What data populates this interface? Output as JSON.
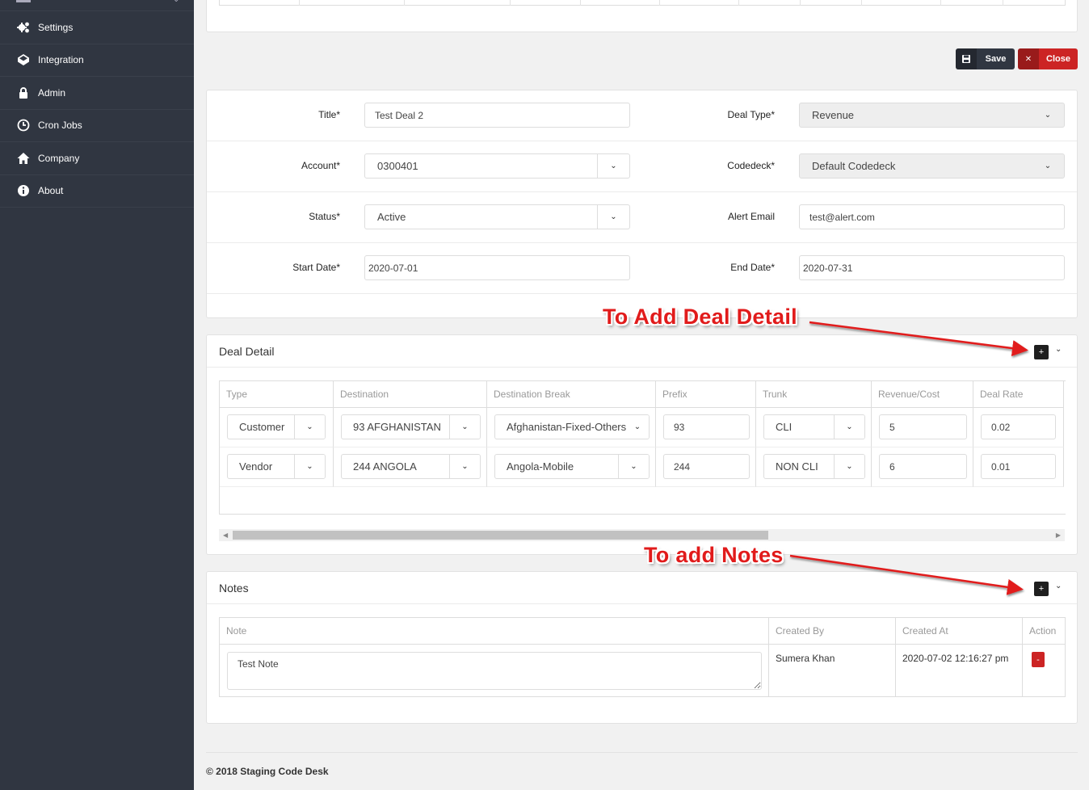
{
  "sidebar": {
    "items": [
      {
        "label": "Settings",
        "icon": "gears-icon"
      },
      {
        "label": "Integration",
        "icon": "codepen-icon"
      },
      {
        "label": "Admin",
        "icon": "lock-icon"
      },
      {
        "label": "Cron Jobs",
        "icon": "clock-icon"
      },
      {
        "label": "Company",
        "icon": "home-icon"
      },
      {
        "label": "About",
        "icon": "info-icon"
      }
    ]
  },
  "toolbar": {
    "save_label": "Save",
    "close_label": "Close",
    "save_icon": "floppy-icon",
    "close_icon": "times-icon",
    "close_color": "#cc2424"
  },
  "form": {
    "title_label": "Title*",
    "title_value": "Test Deal 2",
    "deal_type_label": "Deal Type*",
    "deal_type_value": "Revenue",
    "account_label": "Account*",
    "account_value": "0300401",
    "codedeck_label": "Codedeck*",
    "codedeck_value": "Default Codedeck",
    "status_label": "Status*",
    "status_value": "Active",
    "alert_email_label": "Alert Email",
    "alert_email_value": "test@alert.com",
    "start_date_label": "Start Date*",
    "start_date_value": "2020-07-01",
    "end_date_label": "End Date*",
    "end_date_value": "2020-07-31"
  },
  "deal_detail": {
    "title": "Deal Detail",
    "add_label": "+",
    "columns": [
      "Type",
      "Destination",
      "Destination Break",
      "Prefix",
      "Trunk",
      "Revenue/Cost",
      "Deal Rate"
    ],
    "rows": [
      {
        "type": "Customer",
        "destination": "93 AFGHANISTAN",
        "destination_break": "Afghanistan-Fixed-Others",
        "prefix": "93",
        "trunk": "CLI",
        "revenue_cost": "5",
        "deal_rate": "0.02"
      },
      {
        "type": "Vendor",
        "destination": "244 ANGOLA",
        "destination_break": "Angola-Mobile",
        "prefix": "244",
        "trunk": "NON CLI",
        "revenue_cost": "6",
        "deal_rate": "0.01"
      }
    ]
  },
  "notes": {
    "title": "Notes",
    "add_label": "+",
    "columns": [
      "Note",
      "Created By",
      "Created At",
      "Action"
    ],
    "rows": [
      {
        "note": "Test Note",
        "created_by": "Sumera Khan",
        "created_at": "2020-07-02 12:16:27 pm",
        "action_label": "-"
      }
    ]
  },
  "annotations": {
    "deal_detail": "To Add Deal Detail",
    "notes": "To add Notes",
    "color": "#e11b1b"
  },
  "footer": {
    "text": "© 2018 Staging Code Desk"
  }
}
